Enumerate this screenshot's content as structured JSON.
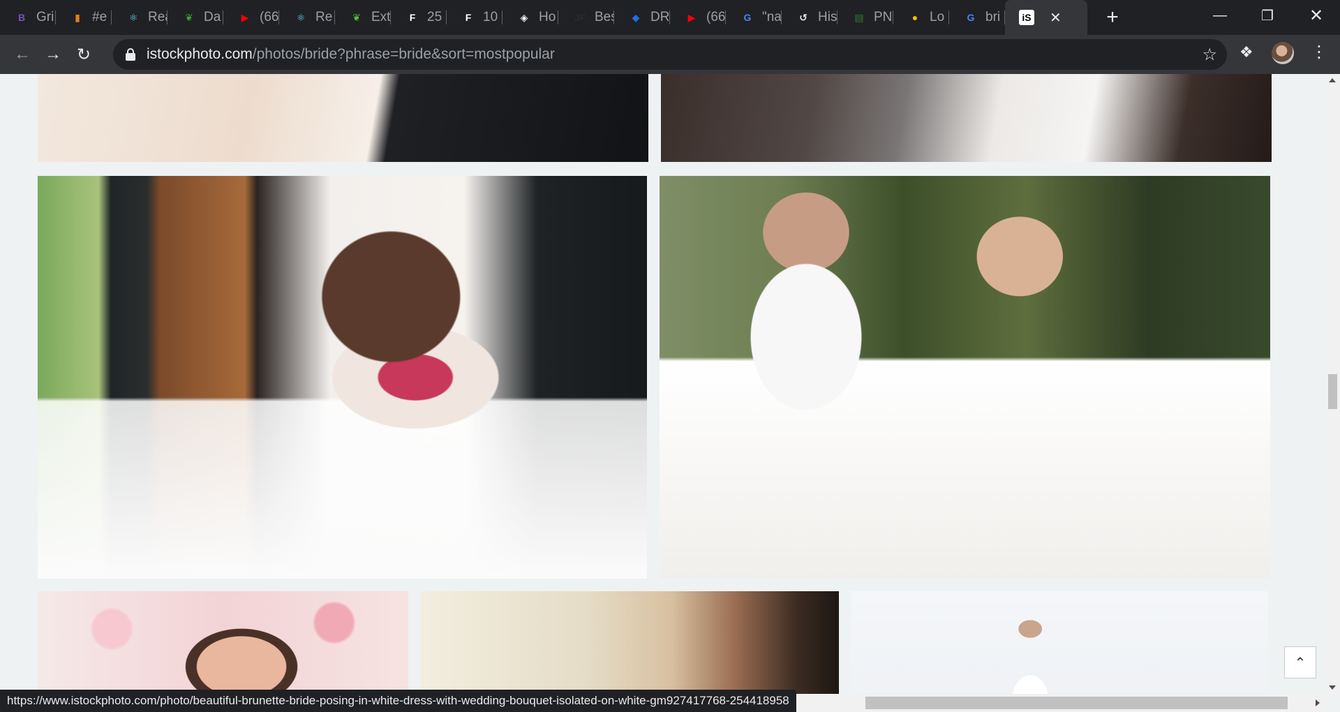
{
  "browser": {
    "tabs": [
      {
        "label": "Gri",
        "icon": "bootstrap-icon",
        "color": "#7952b3",
        "glyph": "B"
      },
      {
        "label": "#e",
        "icon": "rainbow-icon",
        "color": "#e67e22",
        "glyph": "▮"
      },
      {
        "label": "Rea",
        "icon": "react-icon",
        "color": "#61dafb",
        "glyph": "⚛"
      },
      {
        "label": "Da",
        "icon": "leaf-icon",
        "color": "#3fa037",
        "glyph": "❦"
      },
      {
        "label": "(66",
        "icon": "youtube-icon",
        "color": "#ff0000",
        "glyph": "▶"
      },
      {
        "label": "Re",
        "icon": "react-icon",
        "color": "#61dafb",
        "glyph": "⚛"
      },
      {
        "label": "Ext",
        "icon": "leaf-icon",
        "color": "#56c13b",
        "glyph": "❦"
      },
      {
        "label": "25",
        "icon": "framer-f-icon",
        "color": "#ffffff",
        "glyph": "F"
      },
      {
        "label": "10",
        "icon": "framer-f-icon",
        "color": "#ffffff",
        "glyph": "F"
      },
      {
        "label": "Ho",
        "icon": "codepen-icon",
        "color": "#ffffff",
        "glyph": "◈"
      },
      {
        "label": "Bes",
        "icon": "jf-icon",
        "color": "#2b2b2b",
        "glyph": "JF"
      },
      {
        "label": "DR",
        "icon": "diamond-icon",
        "color": "#1a73e8",
        "glyph": "◆"
      },
      {
        "label": "(66",
        "icon": "youtube-icon",
        "color": "#ff0000",
        "glyph": "▶"
      },
      {
        "label": "\"na",
        "icon": "google-icon",
        "color": "#4285f4",
        "glyph": "G"
      },
      {
        "label": "His",
        "icon": "history-icon",
        "color": "#e8eaed",
        "glyph": "↺"
      },
      {
        "label": "PN",
        "icon": "pdf-icon",
        "color": "#2e7d32",
        "glyph": "▤"
      },
      {
        "label": "Lo",
        "icon": "colorful-logo-icon",
        "color": "#fbbc04",
        "glyph": "●"
      },
      {
        "label": "bri",
        "icon": "google-icon",
        "color": "#4285f4",
        "glyph": "G"
      }
    ],
    "active_tab": {
      "icon": "istock-icon",
      "glyph": "iS"
    },
    "new_tab": "+",
    "url_host": "istockphoto.com",
    "url_path": "/photos/bride?phrase=bride&sort=mostpopular",
    "status_url": "https://www.istockphoto.com/photo/beautiful-brunette-bride-posing-in-white-dress-with-wedding-bouquet-isolated-on-white-gm927417768-254418958"
  },
  "colors": {
    "tab_strip": "#202124",
    "toolbar": "#35363a",
    "page_bg": "#eef2f3"
  }
}
